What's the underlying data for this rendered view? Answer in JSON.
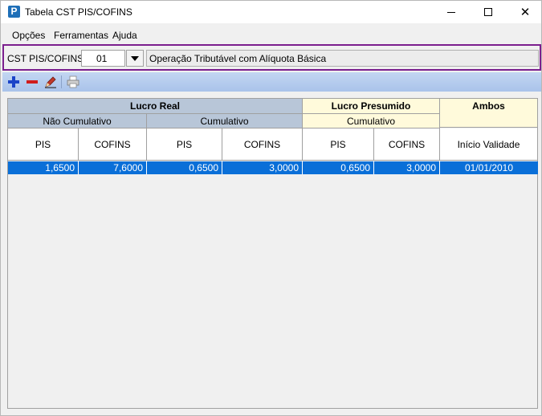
{
  "window": {
    "title": "Tabela CST PIS/COFINS",
    "app_icon_letter": "P",
    "close_glyph": "✕"
  },
  "menu": [
    "Opções",
    "Ferramentas",
    "Ajuda"
  ],
  "filter": {
    "label": "CST PIS/COFINS:",
    "code": "01",
    "description": "Operação Tributável com Alíquota Básica"
  },
  "toolbar": {
    "icons": [
      "add-icon",
      "remove-icon",
      "edit-icon",
      "print-icon"
    ]
  },
  "grid": {
    "groups": {
      "lucro_real": "Lucro Real",
      "lucro_presumido": "Lucro Presumido",
      "ambos": "Ambos"
    },
    "subgroups": {
      "nao_cumulativo": "Não Cumulativo",
      "cumulativo_real": "Cumulativo",
      "cumulativo_presumido": "Cumulativo"
    },
    "columns": [
      "PIS",
      "COFINS",
      "PIS",
      "COFINS",
      "PIS",
      "COFINS",
      "Início Validade"
    ],
    "rows": [
      [
        "1,6500",
        "7,6000",
        "0,6500",
        "3,0000",
        "0,6500",
        "3,0000",
        "01/01/2010"
      ]
    ]
  },
  "colors": {
    "border_highlight": "#7b1f8e",
    "header_real": "#b8c6d8",
    "header_presumido": "#fffadb",
    "selection": "#0a6fd8",
    "toolbar": "#b6cdef"
  }
}
